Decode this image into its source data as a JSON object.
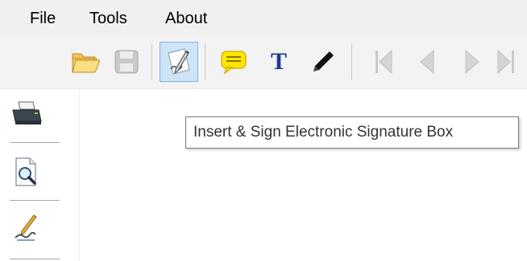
{
  "menu": {
    "items": [
      {
        "label": "File"
      },
      {
        "label": "Tools"
      },
      {
        "label": "About"
      }
    ]
  },
  "toolbar": {
    "buttons": [
      {
        "icon": "open-folder-icon"
      },
      {
        "icon": "save-disk-icon"
      },
      {
        "icon": "signature-pen-icon",
        "active": true
      },
      {
        "icon": "comment-note-icon"
      },
      {
        "icon": "text-tool-icon",
        "glyph": "T"
      },
      {
        "icon": "pencil-icon"
      },
      {
        "icon": "first-page-icon"
      },
      {
        "icon": "previous-page-icon"
      },
      {
        "icon": "next-page-icon"
      },
      {
        "icon": "last-page-icon"
      }
    ],
    "accent_active": "#cde5f7",
    "nav_icon_color": "#c9c9c9"
  },
  "sidebar": {
    "buttons": [
      {
        "icon": "printer-icon"
      },
      {
        "icon": "print-preview-icon"
      },
      {
        "icon": "signature-pen-icon"
      }
    ]
  },
  "tooltip": {
    "text": "Insert & Sign Electronic Signature Box"
  }
}
